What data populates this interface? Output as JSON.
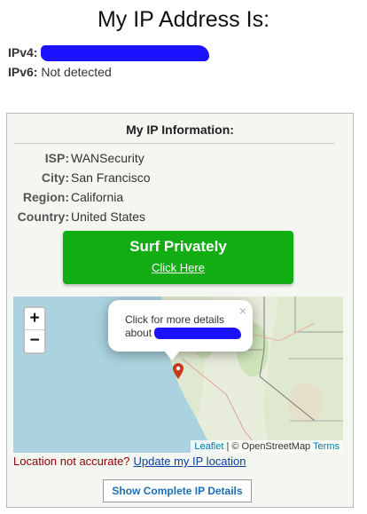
{
  "header": {
    "title": "My IP Address Is:"
  },
  "ip": {
    "ipv4_label": "IPv4:",
    "ipv6_label": "IPv6:",
    "ipv6_value": "Not detected"
  },
  "info": {
    "title": "My IP Information:",
    "rows": [
      {
        "key": "ISP:",
        "value": "WANSecurity"
      },
      {
        "key": "City:",
        "value": "San Francisco"
      },
      {
        "key": "Region:",
        "value": "California"
      },
      {
        "key": "Country:",
        "value": "United States"
      }
    ]
  },
  "surf": {
    "title": "Surf Privately",
    "link": "Click Here"
  },
  "map": {
    "zoom_in": "+",
    "zoom_out": "−",
    "popup_text": "Click for more details about",
    "popup_close": "×",
    "attribution_leaflet": "Leaflet",
    "attribution_middle": " | © OpenStreetMap ",
    "attribution_terms": "Terms"
  },
  "location": {
    "question": "Location not accurate?",
    "link": "Update my IP location"
  },
  "details_button": "Show Complete IP Details",
  "colors": {
    "surf_button": "#12ad12",
    "redaction": "#1a12ff",
    "link": "#0b3f9d",
    "warning": "#8b0000"
  }
}
